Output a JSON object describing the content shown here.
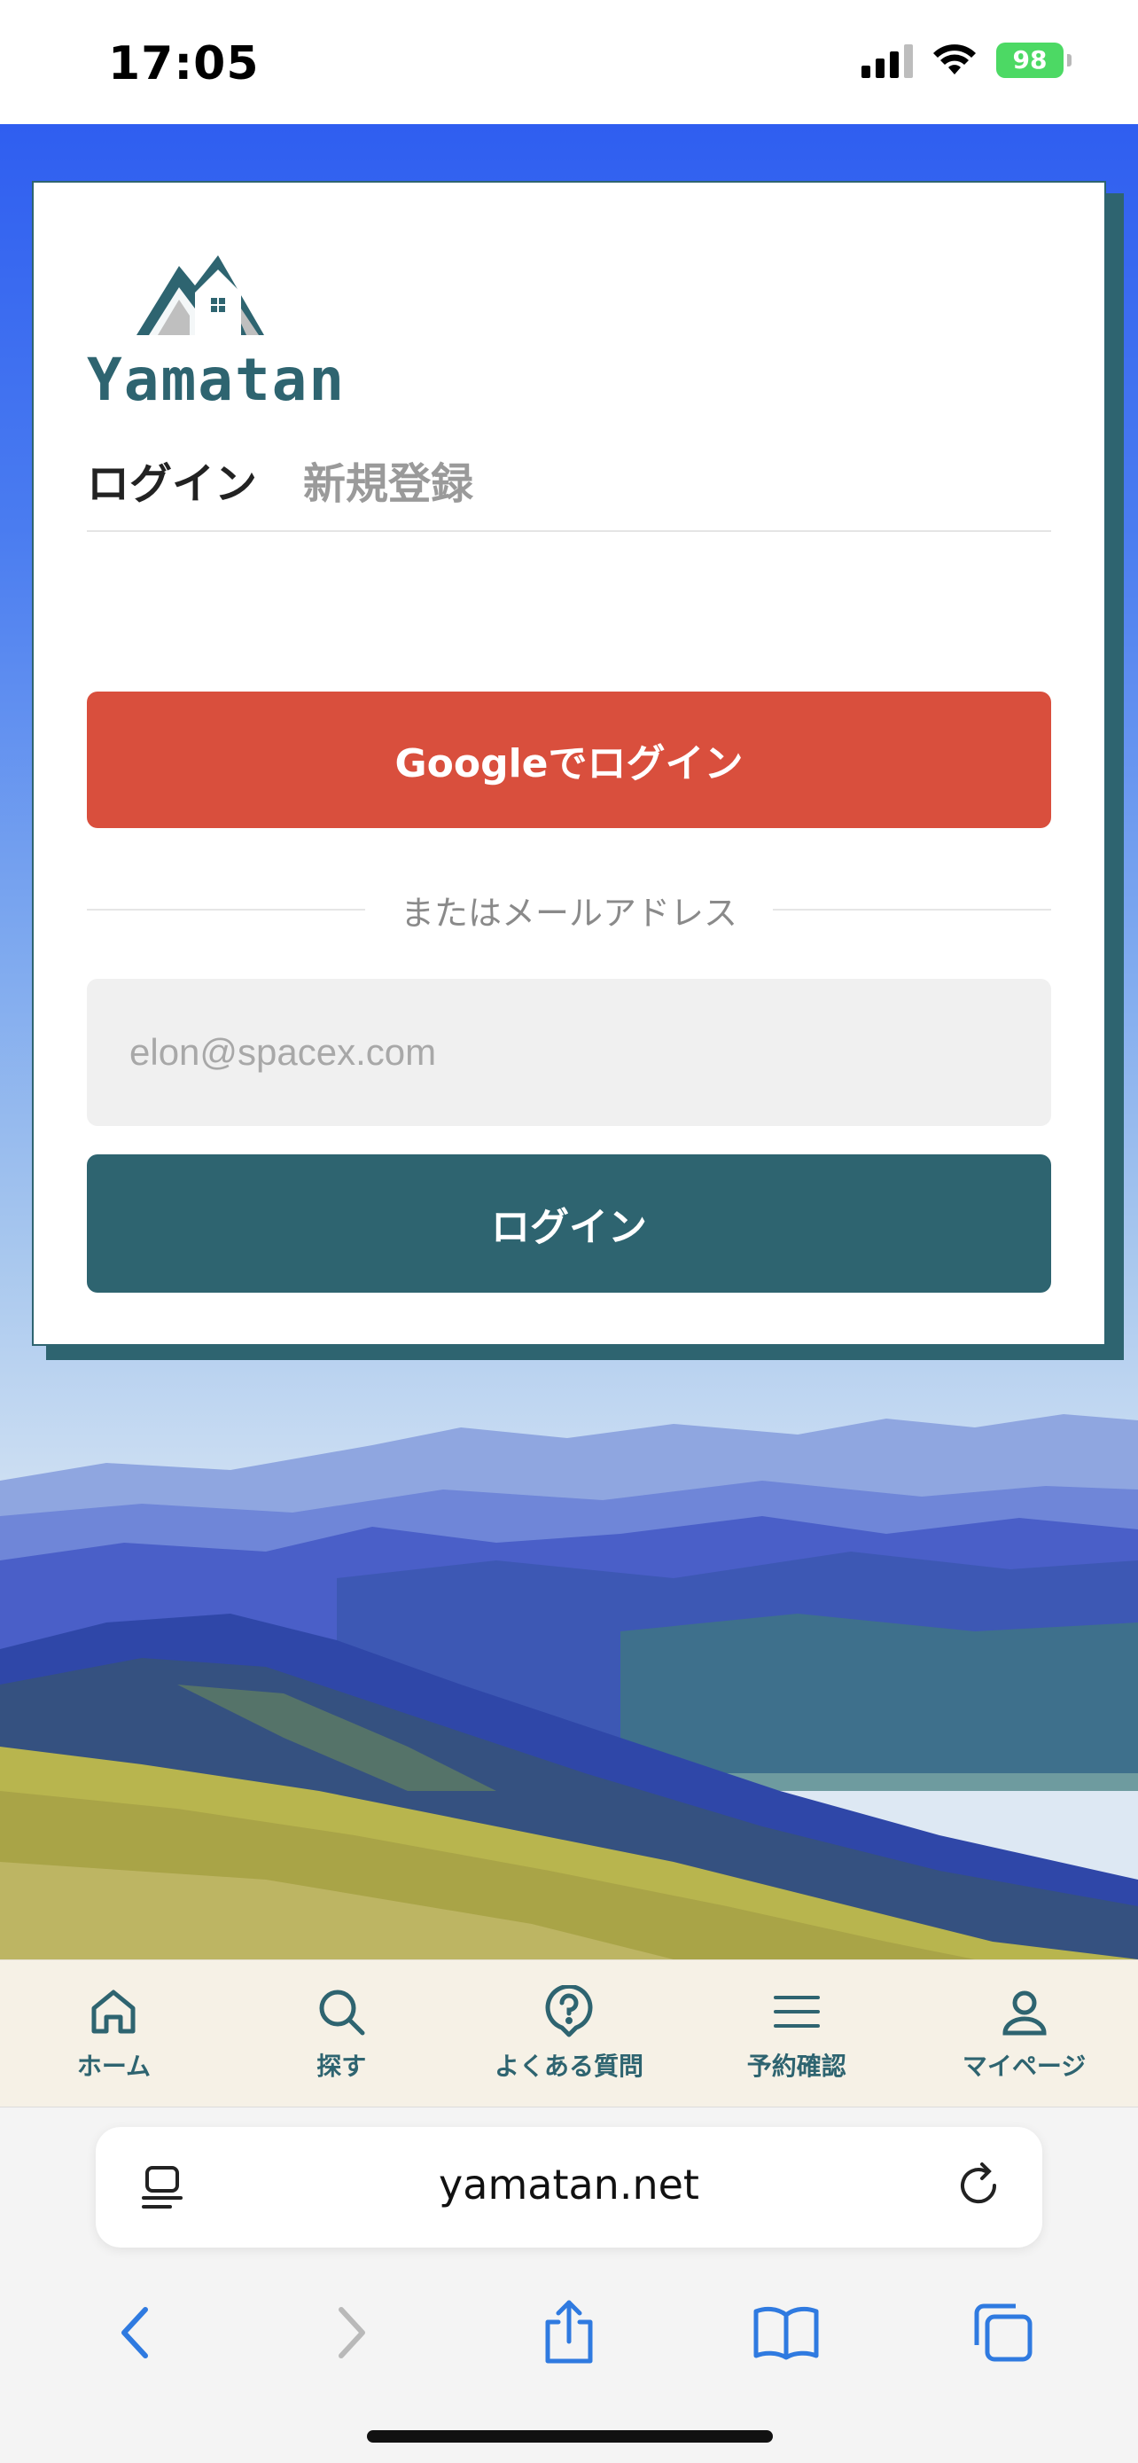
{
  "status_bar": {
    "time": "17:05",
    "battery": "98",
    "icons": [
      "signal-icon",
      "wifi-icon",
      "battery-icon"
    ]
  },
  "brand": {
    "name": "Yamatan",
    "primary_color": "#2e6470",
    "google_color": "#d94f3d"
  },
  "auth": {
    "tabs": [
      {
        "label": "ログイン",
        "active": true
      },
      {
        "label": "新規登録",
        "active": false
      }
    ],
    "google_button": "Googleでログイン",
    "divider_text": "またはメールアドレス",
    "email_placeholder": "elon@spacex.com",
    "login_button": "ログイン"
  },
  "bottom_nav": {
    "items": [
      {
        "label": "ホーム",
        "icon": "home-icon"
      },
      {
        "label": "探す",
        "icon": "search-icon"
      },
      {
        "label": "よくある質問",
        "icon": "question-icon"
      },
      {
        "label": "予約確認",
        "icon": "menu-icon"
      },
      {
        "label": "マイページ",
        "icon": "user-icon"
      }
    ]
  },
  "browser": {
    "url": "yamatan.net",
    "toolbar_icons": [
      "back-icon",
      "forward-icon",
      "share-icon",
      "bookmarks-icon",
      "tabs-icon"
    ]
  }
}
